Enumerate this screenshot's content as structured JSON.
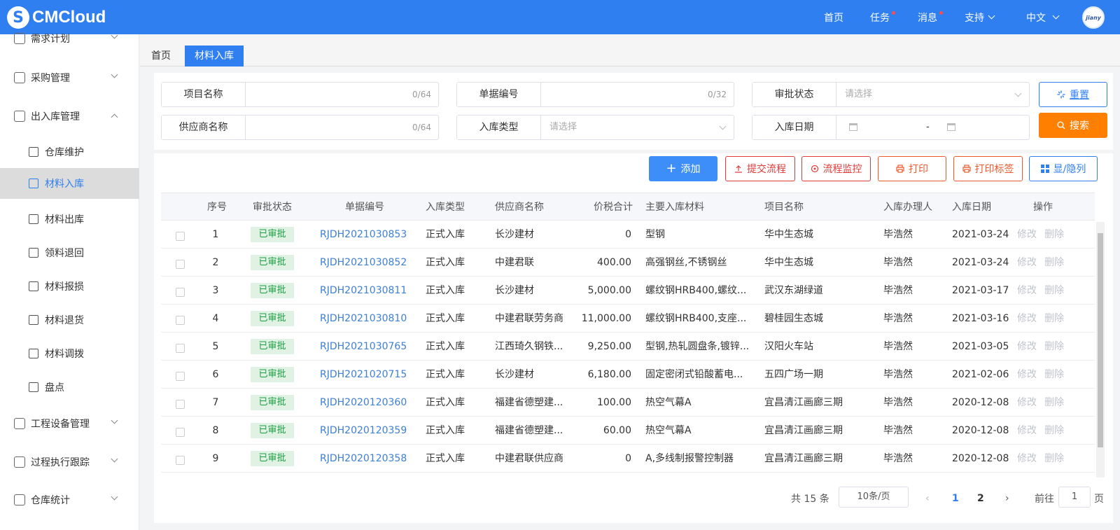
{
  "app": {
    "logo_mark": "S",
    "logo_text": "CMCloud"
  },
  "topnav": {
    "home": "首页",
    "tasks": "任务",
    "messages": "消息",
    "support": "支持",
    "language": "中文",
    "avatar_text": "jiany"
  },
  "sidebar": {
    "items": [
      {
        "label": "需求计划"
      },
      {
        "label": "采购管理"
      },
      {
        "label": "出入库管理"
      },
      {
        "label": "工程设备管理"
      },
      {
        "label": "过程执行跟踪"
      },
      {
        "label": "仓库统计"
      }
    ],
    "subitems": [
      {
        "label": "仓库维护"
      },
      {
        "label": "材料入库"
      },
      {
        "label": "材料出库"
      },
      {
        "label": "领料退回"
      },
      {
        "label": "材料报损"
      },
      {
        "label": "材料退货"
      },
      {
        "label": "材料调拨"
      },
      {
        "label": "盘点"
      }
    ]
  },
  "tabs": [
    {
      "label": "首页"
    },
    {
      "label": "材料入库"
    }
  ],
  "filters": {
    "project_name": {
      "label": "项目名称",
      "count": "0/64"
    },
    "doc_no": {
      "label": "单据编号",
      "count": "0/32"
    },
    "approval_status": {
      "label": "审批状态",
      "placeholder": "请选择"
    },
    "supplier": {
      "label": "供应商名称",
      "count": "0/64"
    },
    "in_type": {
      "label": "入库类型",
      "placeholder": "请选择"
    },
    "in_date": {
      "label": "入库日期",
      "sep": "-"
    },
    "reset": "重置",
    "search": "搜索"
  },
  "actions": {
    "add": "添加",
    "submit_flow": "提交流程",
    "flow_monitor": "流程监控",
    "print": "打印",
    "print_label": "打印标签",
    "toggle_columns": "显/隐列"
  },
  "table": {
    "headers": [
      "序号",
      "审批状态",
      "单据编号",
      "入库类型",
      "供应商名称",
      "价税合计",
      "主要入库材料",
      "项目名称",
      "入库办理人",
      "入库日期",
      "操作"
    ],
    "edit_label": "修改",
    "delete_label": "删除",
    "rows": [
      {
        "no": "1",
        "status": "已审批",
        "doc": "RJDH2021030853",
        "type": "正式入库",
        "supplier": "长沙建材",
        "amount": "0",
        "material": "型钢",
        "project": "华中生态城",
        "handler": "毕浩然",
        "date": "2021-03-24"
      },
      {
        "no": "2",
        "status": "已审批",
        "doc": "RJDH2021030852",
        "type": "正式入库",
        "supplier": "中建君联",
        "amount": "400.00",
        "material": "高强钢丝,不锈钢丝",
        "project": "华中生态城",
        "handler": "毕浩然",
        "date": "2021-03-24"
      },
      {
        "no": "3",
        "status": "已审批",
        "doc": "RJDH2021030811",
        "type": "正式入库",
        "supplier": "长沙建材",
        "amount": "5,000.00",
        "material": "螺纹钢HRB400,螺纹...",
        "project": "武汉东湖绿道",
        "handler": "毕浩然",
        "date": "2021-03-17"
      },
      {
        "no": "4",
        "status": "已审批",
        "doc": "RJDH2021030810",
        "type": "正式入库",
        "supplier": "中建君联劳务商",
        "amount": "11,000.00",
        "material": "螺纹钢HRB400,支座...",
        "project": "碧桂园生态城",
        "handler": "毕浩然",
        "date": "2021-03-16"
      },
      {
        "no": "5",
        "status": "已审批",
        "doc": "RJDH2021030765",
        "type": "正式入库",
        "supplier": "江西琦久钢铁...",
        "amount": "9,250.00",
        "material": "型钢,热轧圆盘条,镀锌...",
        "project": "汉阳火车站",
        "handler": "毕浩然",
        "date": "2021-03-05"
      },
      {
        "no": "6",
        "status": "已审批",
        "doc": "RJDH2021020715",
        "type": "正式入库",
        "supplier": "长沙建材",
        "amount": "6,180.00",
        "material": "固定密闭式铅酸蓄电...",
        "project": "五四广场一期",
        "handler": "毕浩然",
        "date": "2021-02-06"
      },
      {
        "no": "7",
        "status": "已审批",
        "doc": "RJDH2020120360",
        "type": "正式入库",
        "supplier": "福建省德塑建...",
        "amount": "100.00",
        "material": "热空气幕A",
        "project": "宜昌清江画廊三期",
        "handler": "毕浩然",
        "date": "2020-12-08"
      },
      {
        "no": "8",
        "status": "已审批",
        "doc": "RJDH2020120359",
        "type": "正式入库",
        "supplier": "福建省德塑建...",
        "amount": "60.00",
        "material": "热空气幕A",
        "project": "宜昌清江画廊三期",
        "handler": "毕浩然",
        "date": "2020-12-08"
      },
      {
        "no": "9",
        "status": "已审批",
        "doc": "RJDH2020120358",
        "type": "正式入库",
        "supplier": "中建君联供应商",
        "amount": "0",
        "material": "A,多线制报警控制器",
        "project": "宜昌清江画廊三期",
        "handler": "毕浩然",
        "date": "2020-12-08"
      }
    ]
  },
  "pagination": {
    "total": "共 15 条",
    "page_size": "10条/页",
    "pages": [
      "1",
      "2"
    ],
    "goto_prefix": "前往",
    "goto_value": "1",
    "goto_suffix": "页"
  }
}
